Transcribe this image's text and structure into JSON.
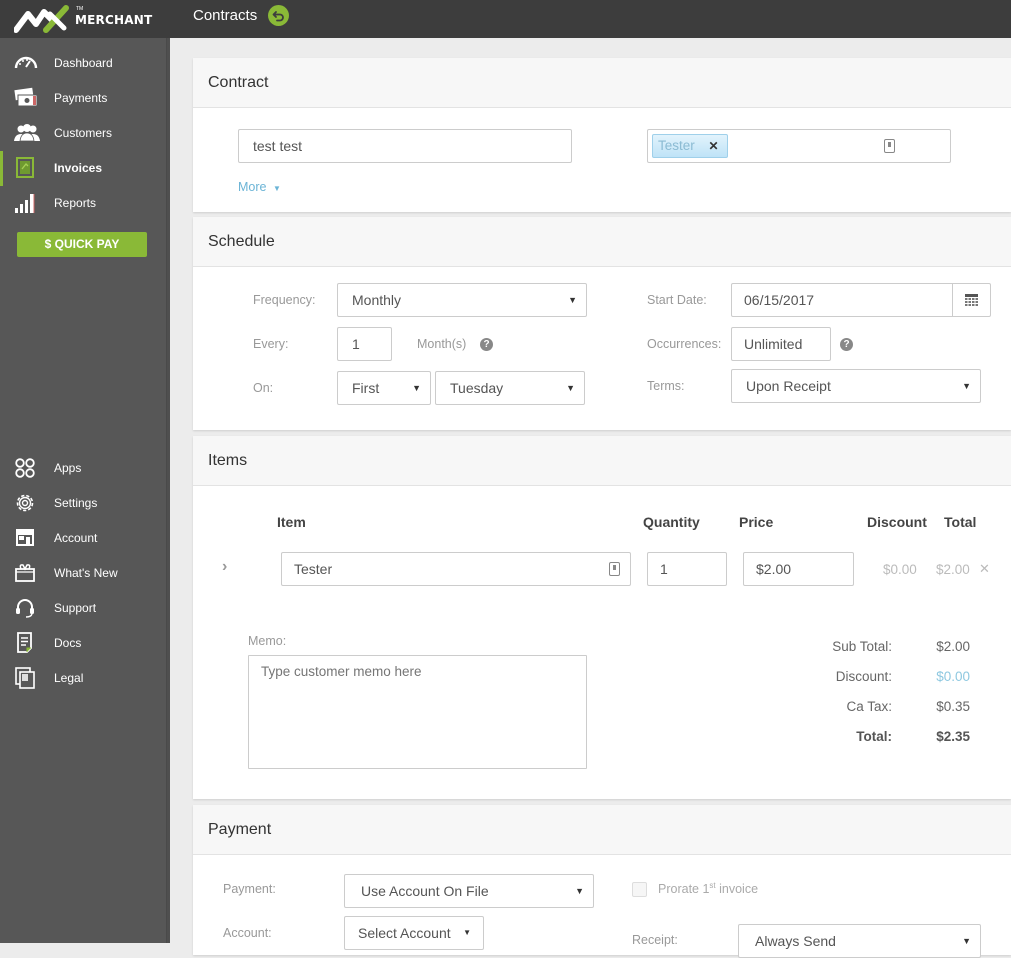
{
  "header": {
    "brand": "MERCHANT",
    "brand_tm": "TM",
    "page_title": "Contracts",
    "title_icon": "back-arrow-icon"
  },
  "sidebar": {
    "items": [
      {
        "label": "Dashboard",
        "icon": "dashboard-gauge-icon",
        "active": false
      },
      {
        "label": "Payments",
        "icon": "money-bills-icon",
        "active": false
      },
      {
        "label": "Customers",
        "icon": "users-group-icon",
        "active": false
      },
      {
        "label": "Invoices",
        "icon": "invoice-document-icon",
        "active": true
      },
      {
        "label": "Reports",
        "icon": "bar-chart-icon",
        "active": false
      }
    ],
    "quick_pay_label": "$ QUICK PAY",
    "bottom_items": [
      {
        "label": "Apps",
        "icon": "apps-grid-icon"
      },
      {
        "label": "Settings",
        "icon": "gear-icon"
      },
      {
        "label": "Account",
        "icon": "storefront-icon"
      },
      {
        "label": "What's New",
        "icon": "gift-icon"
      },
      {
        "label": "Support",
        "icon": "headset-icon"
      },
      {
        "label": "Docs",
        "icon": "document-icon"
      },
      {
        "label": "Legal",
        "icon": "legal-copy-icon"
      }
    ]
  },
  "contract": {
    "title": "Contract",
    "name_value": "test test",
    "customer_tag": "Tester",
    "more_label": "More"
  },
  "schedule": {
    "title": "Schedule",
    "frequency_label": "Frequency:",
    "frequency_value": "Monthly",
    "every_label": "Every:",
    "every_value": "1",
    "every_unit": "Month(s)",
    "on_label": "On:",
    "on_ordinal": "First",
    "on_day": "Tuesday",
    "start_date_label": "Start Date:",
    "start_date_value": "06/15/2017",
    "occurrences_label": "Occurrences:",
    "occurrences_value": "Unlimited",
    "terms_label": "Terms:",
    "terms_value": "Upon Receipt"
  },
  "items": {
    "title": "Items",
    "columns": {
      "item": "Item",
      "quantity": "Quantity",
      "price": "Price",
      "discount": "Discount",
      "total": "Total"
    },
    "rows": [
      {
        "item": "Tester",
        "quantity": "1",
        "price": "$2.00",
        "discount": "$0.00",
        "total": "$2.00"
      }
    ],
    "memo_label": "Memo:",
    "memo_placeholder": "Type customer memo here",
    "totals": {
      "subtotal_label": "Sub Total:",
      "subtotal_value": "$2.00",
      "discount_label": "Discount:",
      "discount_value": "$0.00",
      "tax_label": "Ca Tax:",
      "tax_value": "$0.35",
      "total_label": "Total:",
      "total_value": "$2.35"
    }
  },
  "payment": {
    "title": "Payment",
    "payment_label": "Payment:",
    "payment_value": "Use Account On File",
    "account_label": "Account:",
    "account_value": "Select Account",
    "prorate_label": "Prorate 1",
    "prorate_sup": "st",
    "prorate_suffix": " invoice",
    "prorate_checked": false,
    "receipt_label": "Receipt:",
    "receipt_value": "Always Send"
  },
  "colors": {
    "accent_green": "#8ab937",
    "link_blue": "#6bb4d6",
    "sidebar_bg": "#575757",
    "topbar_bg": "#3d3d3d"
  }
}
